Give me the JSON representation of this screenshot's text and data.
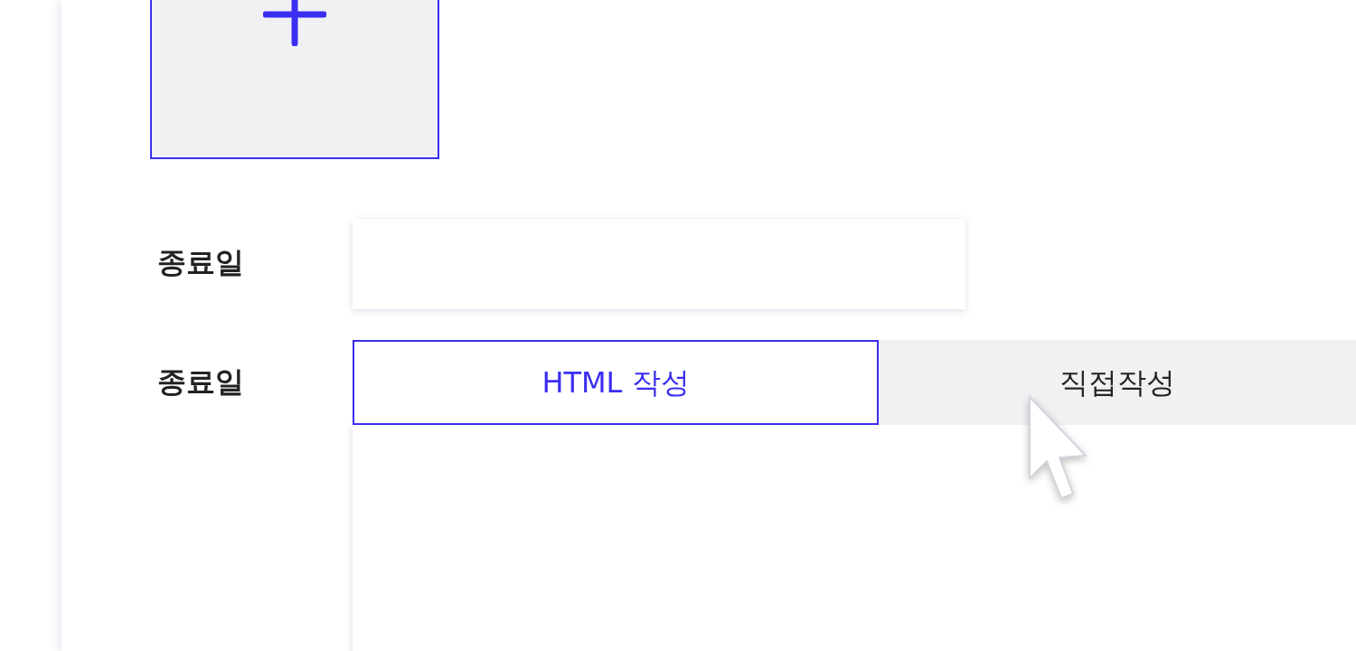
{
  "rows": [
    {
      "label": "종료일",
      "kind": "text"
    },
    {
      "label": "종료일",
      "kind": "editor",
      "tabs": [
        {
          "label": "HTML 작성",
          "selected": true
        },
        {
          "label": "직접작성",
          "selected": false
        }
      ]
    }
  ]
}
